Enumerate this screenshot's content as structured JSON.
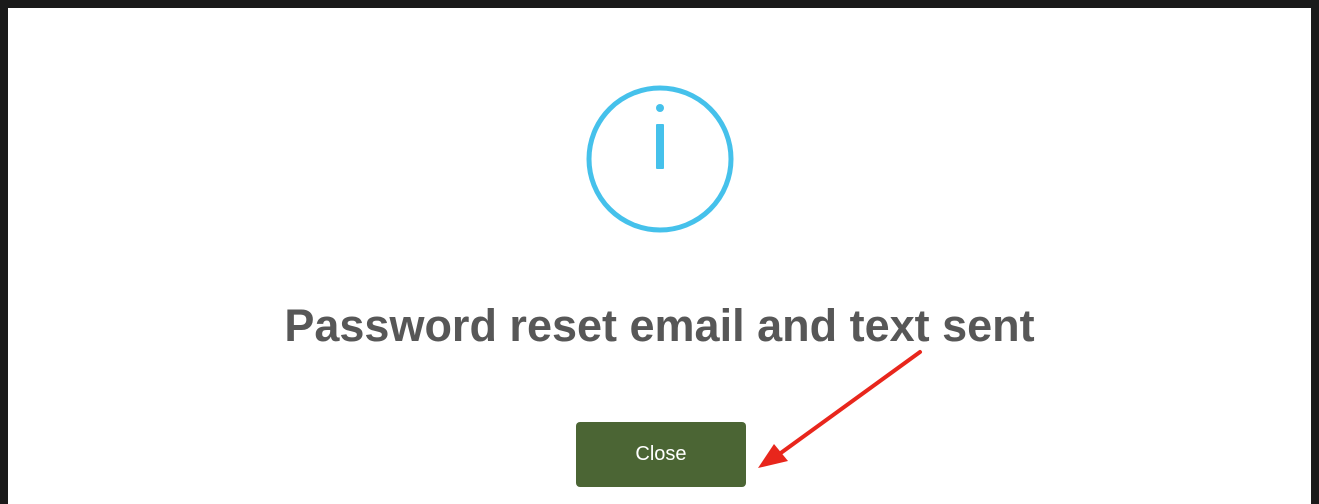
{
  "dialog": {
    "title": "Password reset email and text sent",
    "icon": "info-icon",
    "close_label": "Close"
  },
  "colors": {
    "icon": "#45c1eb",
    "title": "#575757",
    "button": "#4b6534",
    "button_text": "#ffffff",
    "arrow": "#e8261c"
  }
}
